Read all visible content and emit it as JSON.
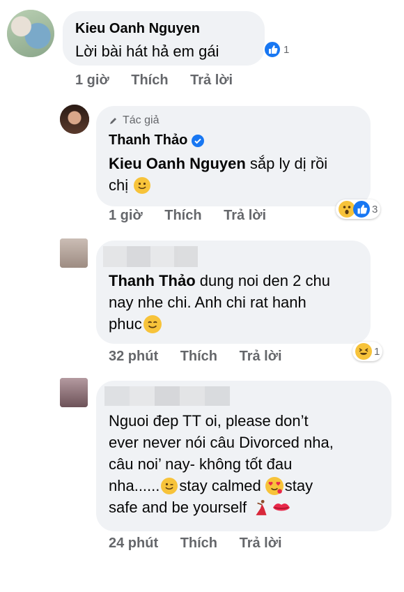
{
  "comments": [
    {
      "author": "Kieu Oanh Nguyen",
      "text": "Lời bài hát hả em gái",
      "time": "1 giờ",
      "like_label": "Thích",
      "reply_label": "Trả lời",
      "reaction_count": "1"
    },
    {
      "badge_label": "Tác giả",
      "author": "Thanh Thảo",
      "mention": "Kieu Oanh Nguyen",
      "text_line1": "sắp ly dị rồi",
      "text_line2": "chị",
      "time": "1 giờ",
      "like_label": "Thích",
      "reply_label": "Trả lời",
      "reaction_count": "3"
    },
    {
      "mention": "Thanh Thảo",
      "text_line1": "dung noi den 2 chu",
      "text_line2": "nay nhe chi. Anh chi rat hanh",
      "text_line3": "phuc",
      "time": "32 phút",
      "like_label": "Thích",
      "reply_label": "Trả lời",
      "reaction_count": "1"
    },
    {
      "line1": "Nguoi đep TT oi, please don’t",
      "line2": "ever never nói câu Divorced nha,",
      "line3": "câu noi’ nay- không tốt đau",
      "line4_a": "nha......",
      "line4_b": "stay calmed",
      "line4_c": "stay",
      "line5": "safe and be yourself",
      "time": "24 phút",
      "like_label": "Thích",
      "reply_label": "Trả lời"
    }
  ],
  "colors": {
    "bubble": "#f0f2f5",
    "meta": "#65676b",
    "verified": "#1877f2",
    "like_blue": "#1877f2",
    "emoji_yellow": "#f7c33a"
  },
  "icons": [
    "verified-icon",
    "pencil-icon",
    "like-reaction-icon",
    "wow-reaction-icon",
    "haha-reaction-icon",
    "smile-emoji-icon",
    "wink-emoji-icon",
    "love-face-emoji-icon",
    "dancer-emoji-icon",
    "lips-emoji-icon"
  ]
}
